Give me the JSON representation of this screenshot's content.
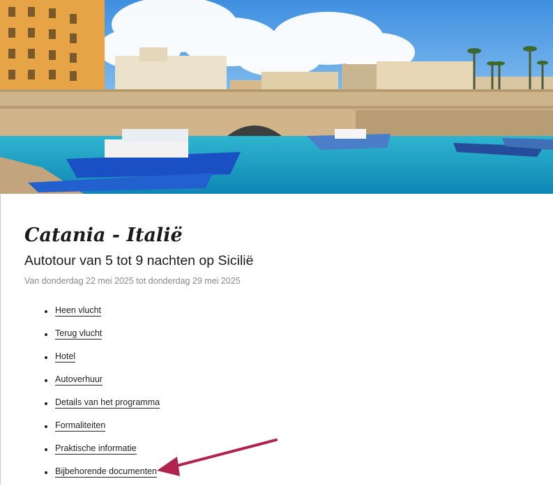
{
  "trip": {
    "title": "Catania - Italië",
    "subtitle": "Autotour van 5 tot 9 nachten op Sicilië",
    "dates": "Van donderdag 22 mei 2025 tot donderdag 29 mei 2025"
  },
  "hero": {
    "icon": "harbor-photo",
    "colors": {
      "sky": "#5fa3e4",
      "water": "#1aa7c8",
      "stone": "#d9c3a0",
      "boat": "#1b4fc4"
    }
  },
  "menu": {
    "items": [
      {
        "label": "Heen vlucht"
      },
      {
        "label": "Terug vlucht"
      },
      {
        "label": "Hotel"
      },
      {
        "label": "Autoverhuur"
      },
      {
        "label": "Details van het programma"
      },
      {
        "label": "Formaliteiten"
      },
      {
        "label": "Praktische informatie"
      },
      {
        "label": "Bijbehorende documenten"
      }
    ]
  },
  "annotation": {
    "icon": "arrow-icon",
    "color": "#b0234f"
  }
}
